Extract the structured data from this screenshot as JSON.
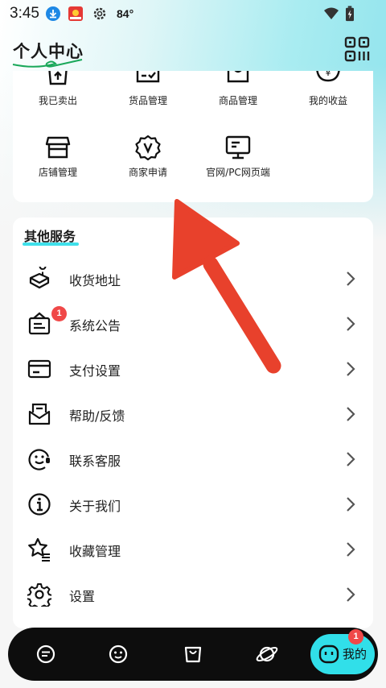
{
  "status_bar": {
    "time": "3:45",
    "temperature": "84°"
  },
  "header": {
    "title": "个人中心"
  },
  "grid": {
    "items": [
      {
        "label": "我已卖出",
        "icon": "sold-bag-icon"
      },
      {
        "label": "货品管理",
        "icon": "goods-checklist-icon"
      },
      {
        "label": "商品管理",
        "icon": "product-bag-icon"
      },
      {
        "label": "我的收益",
        "icon": "earnings-yen-icon"
      },
      {
        "label": "店铺管理",
        "icon": "store-icon"
      },
      {
        "label": "商家申请",
        "icon": "merchant-badge-icon"
      },
      {
        "label": "官网/PC网页端",
        "icon": "monitor-icon"
      }
    ]
  },
  "services": {
    "title": "其他服务",
    "items": [
      {
        "label": "收货地址",
        "icon": "address-map-icon"
      },
      {
        "label": "系统公告",
        "icon": "announcement-icon",
        "badge": "1"
      },
      {
        "label": "支付设置",
        "icon": "card-icon"
      },
      {
        "label": "帮助/反馈",
        "icon": "mail-feedback-icon"
      },
      {
        "label": "联系客服",
        "icon": "customer-service-icon"
      },
      {
        "label": "关于我们",
        "icon": "info-icon"
      },
      {
        "label": "收藏管理",
        "icon": "star-list-icon"
      },
      {
        "label": "设置",
        "icon": "gear-icon"
      }
    ]
  },
  "bottom_nav": {
    "items": [
      {
        "icon": "chat-icon"
      },
      {
        "icon": "smile-icon"
      },
      {
        "icon": "shopping-bag-icon"
      },
      {
        "icon": "planet-icon"
      }
    ],
    "active": {
      "label": "我的",
      "badge": "1",
      "icon": "profile-face-icon"
    }
  },
  "colors": {
    "accent": "#31dfe9",
    "badge": "#f04848",
    "annotation_arrow": "#e8412c"
  }
}
